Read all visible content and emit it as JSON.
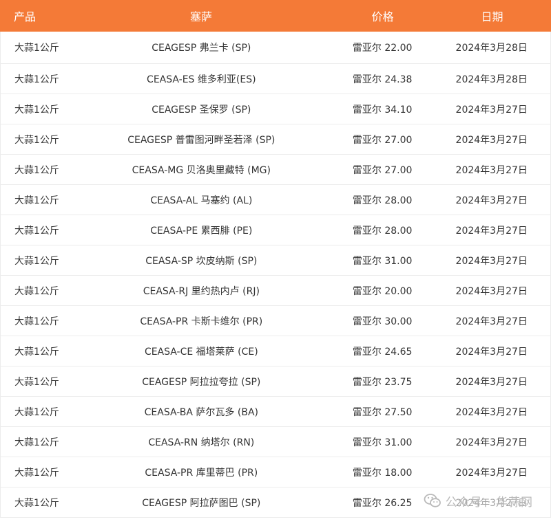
{
  "headers": {
    "product": "产品",
    "market": "塞萨",
    "price": "价格",
    "date": "日期"
  },
  "rows": [
    {
      "product": "大蒜1公斤",
      "market": "CEAGESP 弗兰卡 (SP)",
      "price": "雷亚尔 22.00",
      "date": "2024年3月28日"
    },
    {
      "product": "大蒜1公斤",
      "market": "CEASA-ES 维多利亚(ES)",
      "price": "雷亚尔 24.38",
      "date": "2024年3月28日"
    },
    {
      "product": "大蒜1公斤",
      "market": "CEAGESP 圣保罗 (SP)",
      "price": "雷亚尔 34.10",
      "date": "2024年3月27日"
    },
    {
      "product": "大蒜1公斤",
      "market": "CEAGESP 普雷图河畔圣若泽 (SP)",
      "price": "雷亚尔 27.00",
      "date": "2024年3月27日"
    },
    {
      "product": "大蒜1公斤",
      "market": "CEASA-MG 贝洛奥里藏特 (MG)",
      "price": "雷亚尔 27.00",
      "date": "2024年3月27日"
    },
    {
      "product": "大蒜1公斤",
      "market": "CEASA-AL 马塞约 (AL)",
      "price": "雷亚尔 28.00",
      "date": "2024年3月27日"
    },
    {
      "product": "大蒜1公斤",
      "market": "CEASA-PE 累西腓 (PE)",
      "price": "雷亚尔 28.00",
      "date": "2024年3月27日"
    },
    {
      "product": "大蒜1公斤",
      "market": "CEASA-SP 坎皮纳斯 (SP)",
      "price": "雷亚尔 31.00",
      "date": "2024年3月27日"
    },
    {
      "product": "大蒜1公斤",
      "market": "CEASA-RJ 里约热内卢 (RJ)",
      "price": "雷亚尔 20.00",
      "date": "2024年3月27日"
    },
    {
      "product": "大蒜1公斤",
      "market": "CEASA-PR 卡斯卡维尔 (PR)",
      "price": "雷亚尔 30.00",
      "date": "2024年3月27日"
    },
    {
      "product": "大蒜1公斤",
      "market": "CEASA-CE 福塔莱萨 (CE)",
      "price": "雷亚尔 24.65",
      "date": "2024年3月27日"
    },
    {
      "product": "大蒜1公斤",
      "market": "CEAGESP 阿拉拉夸拉 (SP)",
      "price": "雷亚尔 23.75",
      "date": "2024年3月27日"
    },
    {
      "product": "大蒜1公斤",
      "market": "CEASA-BA 萨尔瓦多 (BA)",
      "price": "雷亚尔 27.50",
      "date": "2024年3月27日"
    },
    {
      "product": "大蒜1公斤",
      "market": "CEASA-RN 纳塔尔 (RN)",
      "price": "雷亚尔 31.00",
      "date": "2024年3月27日"
    },
    {
      "product": "大蒜1公斤",
      "market": "CEASA-PR 库里蒂巴 (PR)",
      "price": "雷亚尔 18.00",
      "date": "2024年3月27日"
    },
    {
      "product": "大蒜1公斤",
      "market": "CEAGESP 阿拉萨图巴 (SP)",
      "price": "雷亚尔 26.25",
      "date": "2024年3月27日"
    }
  ],
  "watermark": {
    "text": "公众号 · 华蒜网",
    "icon": "wechat-icon"
  },
  "colors": {
    "header_bg": "#f47a37",
    "header_text": "#ffffff",
    "row_border": "#ececec",
    "body_text": "#333333"
  }
}
